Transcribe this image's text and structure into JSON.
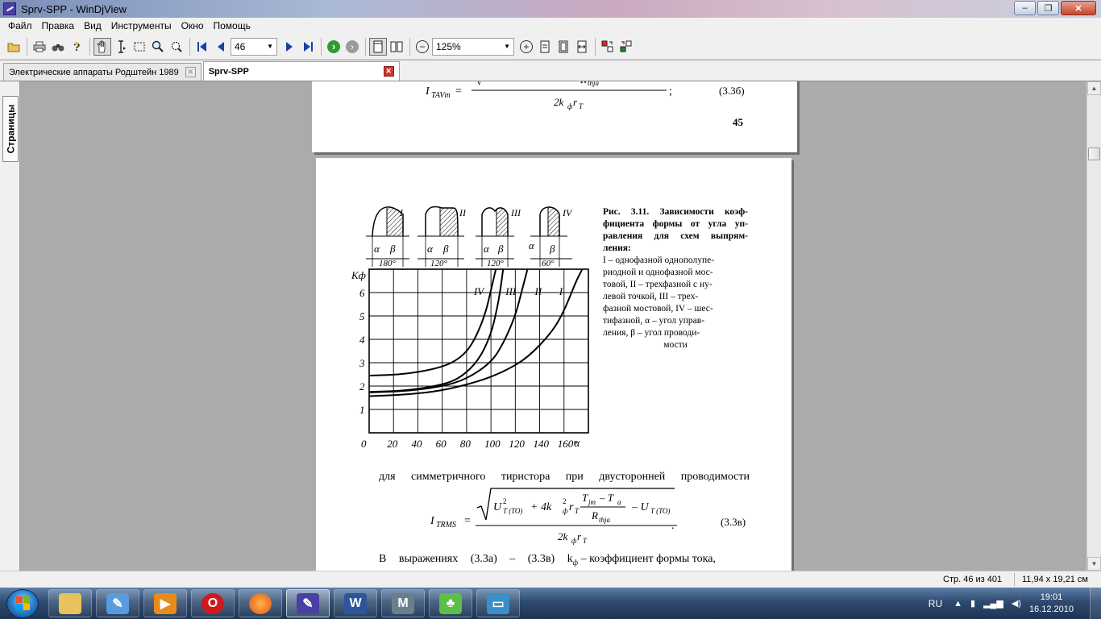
{
  "window": {
    "title": "Sprv-SPP - WinDjView",
    "controls": {
      "minimize": "‒",
      "maximize": "❐",
      "close": "✕"
    }
  },
  "menu": [
    "Файл",
    "Правка",
    "Вид",
    "Инструменты",
    "Окно",
    "Помощь"
  ],
  "toolbar": {
    "page_value": "46",
    "zoom_value": "125%"
  },
  "tabs": [
    {
      "label": "Электрические аппараты Родштейн 1989",
      "active": false
    },
    {
      "label": "Sprv-SPP",
      "active": true
    }
  ],
  "sidebar": {
    "pages_tab_label": "Страницы"
  },
  "document": {
    "prev_page": {
      "formula_lhs": "I",
      "formula_lhs_sub": "TAVm",
      "formula_numer_fragment": "R",
      "formula_numer_sub": "thja",
      "formula_denom": "2k",
      "formula_denom_sub": "ф",
      "formula_denom_tail": "r",
      "formula_denom_tail_sub": "T",
      "formula_tail": ";",
      "eq_number": "(3.3б)",
      "page_number": "45"
    },
    "figure": {
      "scheme_labels": [
        "I",
        "II",
        "III",
        "IV"
      ],
      "alpha": "α",
      "beta": "β",
      "span_labels": [
        "180°",
        "120°",
        "120°",
        "60°"
      ],
      "caption_title": "Рис. 3.11. Зависимости коэф-фициента формы от угла уп-равления для схем выпрям-ления:",
      "caption_lines": [
        "I – однофазной однополупе-",
        "риодной и однофазной мос-",
        "товой, II – трехфазной с ну-",
        "левой точкой, III – трех-",
        "фазной мостовой, IV – шес-",
        "тифазной, α – угол управ-",
        "ления, β – угол проводи-",
        "мости"
      ]
    },
    "body_text_1": "для симметричного тиристора при двусторонней проводимости",
    "formula2": {
      "lhs": "I",
      "lhs_sub": "TRMS",
      "u1": "U",
      "u1_sup": "2",
      "u1_sub": "T (TO)",
      "plus": "+ 4k",
      "k_sup": "2",
      "k_sub": "ф",
      "rt": "r",
      "rt_sub": "T",
      "frac_num": "T",
      "frac_num_sub": "jm",
      "frac_num_minus": "– T",
      "frac_num_minus_sub": "a",
      "frac_den": "R",
      "frac_den_sub": "thja",
      "minus_u": "– U",
      "minus_u_sub": "T (TO)",
      "denom": "2k",
      "denom_sub": "ф",
      "denom_tail": "r",
      "denom_tail_sub": "T",
      "period": ".",
      "eq_number": "(3.3в)"
    },
    "body_text_2": "В выражениях (3.3а) – (3.3в) k",
    "body_text_2_sub": "ф",
    "body_text_2_tail": "– коэффициент формы тока,"
  },
  "chart_data": {
    "type": "line",
    "title": "",
    "xlabel": "α",
    "ylabel": "Кф",
    "x_ticks": [
      "0",
      "20",
      "40",
      "60",
      "80",
      "100",
      "120",
      "140",
      "160°"
    ],
    "y_ticks": [
      "1",
      "2",
      "3",
      "4",
      "5",
      "6"
    ],
    "xlim": [
      0,
      180
    ],
    "ylim": [
      0,
      7
    ],
    "grid": true,
    "series": [
      {
        "name": "I",
        "x": [
          0,
          30,
          60,
          90,
          110,
          130,
          150,
          160,
          170,
          175
        ],
        "y": [
          1.57,
          1.63,
          1.8,
          2.2,
          2.6,
          3.2,
          4.3,
          5.2,
          6.5,
          7.0
        ]
      },
      {
        "name": "II",
        "x": [
          0,
          30,
          60,
          80,
          100,
          110,
          120,
          125,
          130
        ],
        "y": [
          1.73,
          1.78,
          1.98,
          2.3,
          3.0,
          3.8,
          5.0,
          6.0,
          7.0
        ]
      },
      {
        "name": "III",
        "x": [
          0,
          30,
          60,
          75,
          90,
          100,
          105,
          108,
          110
        ],
        "y": [
          1.75,
          1.8,
          2.05,
          2.35,
          3.1,
          4.2,
          5.3,
          6.2,
          7.0
        ]
      },
      {
        "name": "IV",
        "x": [
          0,
          30,
          60,
          75,
          85,
          95,
          100,
          104
        ],
        "y": [
          2.45,
          2.5,
          2.8,
          3.2,
          3.8,
          5.0,
          6.1,
          7.0
        ]
      }
    ]
  },
  "status": {
    "page_info": "Стр. 46 из 401",
    "page_size": "11,94 x 19,21 см"
  },
  "taskbar": {
    "lang": "RU",
    "time": "19:01",
    "date": "16.12.2010",
    "apps": [
      "Проводник",
      "Paint",
      "Проигрыватель",
      "Opera",
      "Firefox",
      "WinDjView",
      "Word",
      "M",
      "Бутылка",
      "Просмотр изображений"
    ]
  }
}
